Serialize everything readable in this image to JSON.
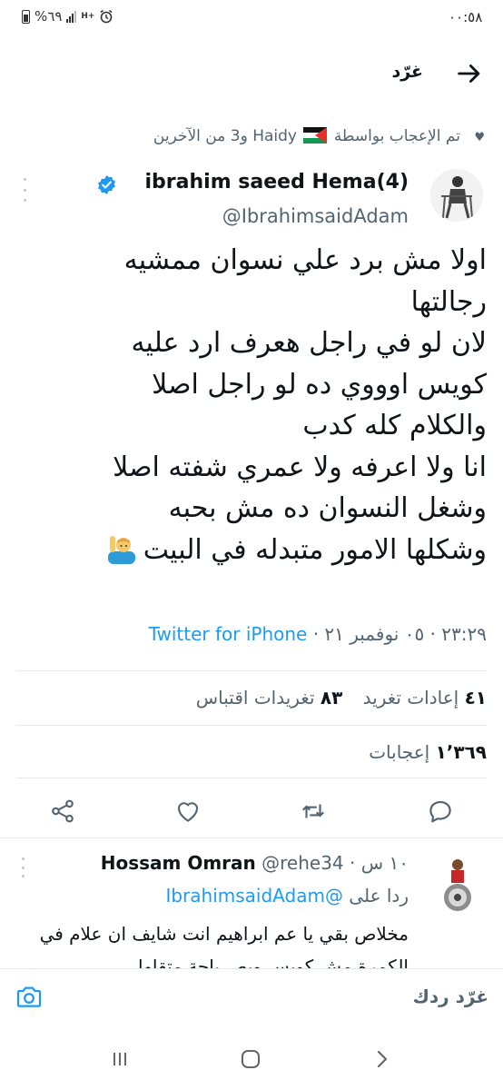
{
  "status_bar": {
    "time": "٠٠:٥٨",
    "battery": "%٦٩",
    "network": "H+"
  },
  "header": {
    "title": "غرّد",
    "back_icon": "arrow-back-icon"
  },
  "social_context": {
    "text_before": "تم الإعجاب بواسطة",
    "name": "Haidy",
    "text_after": "و3 من الآخرين"
  },
  "tweet": {
    "author_name": "ibrahim saeed Hema(4)",
    "handle": "@IbrahimsaidAdam",
    "lines": [
      "اولا مش برد علي نسوان ممشيه",
      "رجالتها",
      "لان لو في راجل هعرف ارد عليه",
      "كويس اوووي ده لو راجل اصلا",
      "والكلام كله كدب",
      "انا ولا اعرفه ولا عمري شفته اصلا",
      "وشغل النسوان ده مش بحبه",
      "وشكلها الامور متبدله في البيت"
    ],
    "time": "٢٣:٢٩",
    "date": "٠٥ نوفمبر ٢١",
    "source": "Twitter for iPhone",
    "separator": "·"
  },
  "stats": {
    "retweets_count": "٤١",
    "retweets_label": "إعادات تغريد",
    "quotes_count": "٨٣",
    "quotes_label": "تغريدات اقتباس",
    "likes_count": "١٬٣٦٩",
    "likes_label": "إعجابات"
  },
  "reply": {
    "name": "Hossam Omran",
    "handle": "@rehe34",
    "time": "١٠ س",
    "replying_to_label": "ردا على",
    "replying_to_handle": "@IbrahimsaidAdam",
    "text": "مخلاص بقي يا عم ابراهيم انت شايف ان علام في الكمرة مش كويس وبص بإجة متقلها"
  },
  "composer": {
    "placeholder": "غرّد ردك"
  },
  "colors": {
    "accent": "#1d9bf0",
    "secondary_text": "#536471",
    "divider": "#e6e9eb"
  }
}
